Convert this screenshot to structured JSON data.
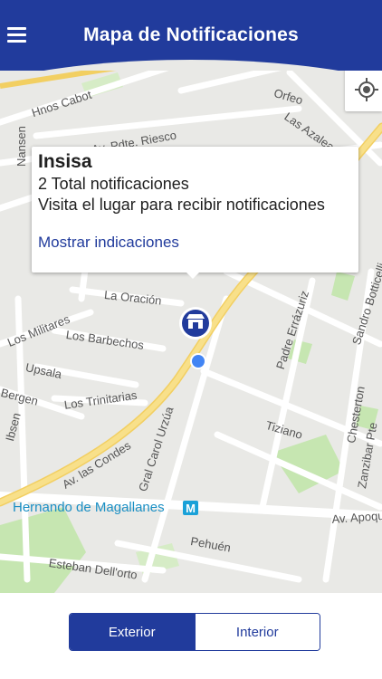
{
  "header": {
    "title": "Mapa de Notificaciones",
    "menu_icon": "hamburger-menu-icon",
    "background_color": "#213b9c"
  },
  "map": {
    "locate_icon": "my-location-crosshair-icon",
    "streets": [
      "Hnos Cabot",
      "Orfeo",
      "Las Azaleas",
      "Nansen",
      "Av. Pdte. Riesco",
      "La Oración",
      "Los Militares",
      "Los Barbechos",
      "Upsala",
      "Los Trinitarias",
      "Bergen",
      "Ibsen",
      "Av. las Condes",
      "Gral Carol Urzúa",
      "Padre Errázuriz",
      "Sandro Botticelli",
      "Tiziano",
      "Chesterton",
      "Zanzibar Pte",
      "Pehuén",
      "Esteban Dell'orto",
      "Av. Apoquindo",
      "Hernando de Magallanes"
    ],
    "metro_station": "Hernando de Magallanes",
    "metro_icon": "M",
    "marker_icon": "store-awning-icon",
    "user_location_icon": "blue-location-dot-icon"
  },
  "popup": {
    "title": "Insisa",
    "line1": "2 Total notificaciones",
    "line2": "Visita el lugar para recibir notificaciones",
    "link": "Mostrar indicaciones"
  },
  "segmented": {
    "exterior": "Exterior",
    "interior": "Interior",
    "selected": "Exterior"
  },
  "colors": {
    "primary": "#213b9c",
    "main_road": "#f5d66b",
    "park": "#c6e6b1",
    "user_dot": "#4285f4",
    "metro": "#1aa1d8"
  }
}
